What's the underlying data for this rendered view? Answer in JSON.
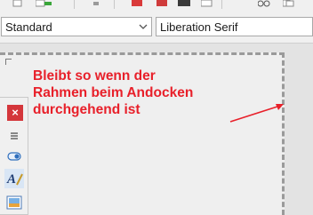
{
  "toolbar": {
    "icons": [
      "new-document-icon",
      "add-icon",
      "dropdown-icon",
      "pdf-export-icon",
      "print-icon",
      "print-preview-icon",
      "cut-icon",
      "copy-icon"
    ]
  },
  "format_bar": {
    "paragraph_style": "Standard",
    "font_name": "Liberation Serif"
  },
  "annotation": {
    "line1": "Bleibt so wenn der",
    "line2": "Rahmen beim Andocken",
    "line3": "durchgehend ist",
    "color": "#e8202a"
  },
  "sidebar": {
    "close_label": "×",
    "buttons": [
      "menu-icon",
      "properties-icon",
      "styles-icon",
      "gallery-icon"
    ]
  }
}
